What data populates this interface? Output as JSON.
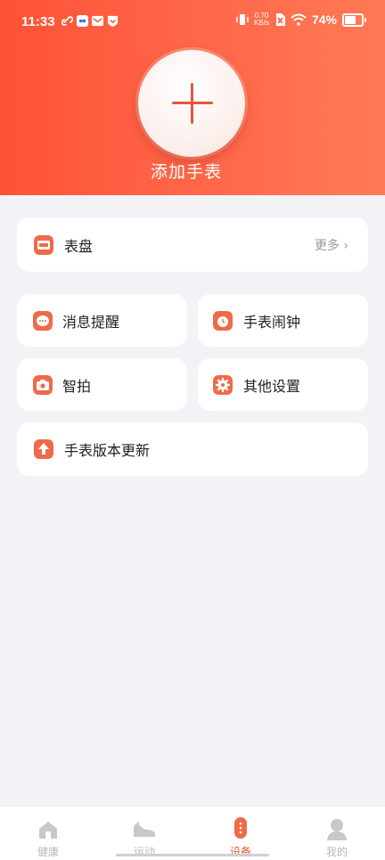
{
  "status_bar": {
    "time": "11:33",
    "net_speed_value": "0.70",
    "net_speed_unit": "KB/s",
    "battery": "74%"
  },
  "header": {
    "add_watch_label": "添加手表"
  },
  "dial_card": {
    "label": "表盘",
    "more": "更多"
  },
  "grid": [
    {
      "label": "消息提醒",
      "icon": "message-icon"
    },
    {
      "label": "手表闹钟",
      "icon": "alarm-clock-icon"
    },
    {
      "label": "智拍",
      "icon": "camera-icon"
    },
    {
      "label": "其他设置",
      "icon": "gear-icon"
    }
  ],
  "update_card": {
    "label": "手表版本更新",
    "icon": "upload-arrow-icon"
  },
  "tabbar": {
    "items": [
      {
        "label": "健康",
        "icon": "home-icon"
      },
      {
        "label": "运动",
        "icon": "shoe-icon"
      },
      {
        "label": "设备",
        "icon": "band-icon",
        "active": true
      },
      {
        "label": "我的",
        "icon": "person-icon"
      }
    ]
  },
  "colors": {
    "accent": "#e8553a",
    "header_start": "#ff5237",
    "header_end": "#ff7a55",
    "background": "#f2f2f7"
  }
}
